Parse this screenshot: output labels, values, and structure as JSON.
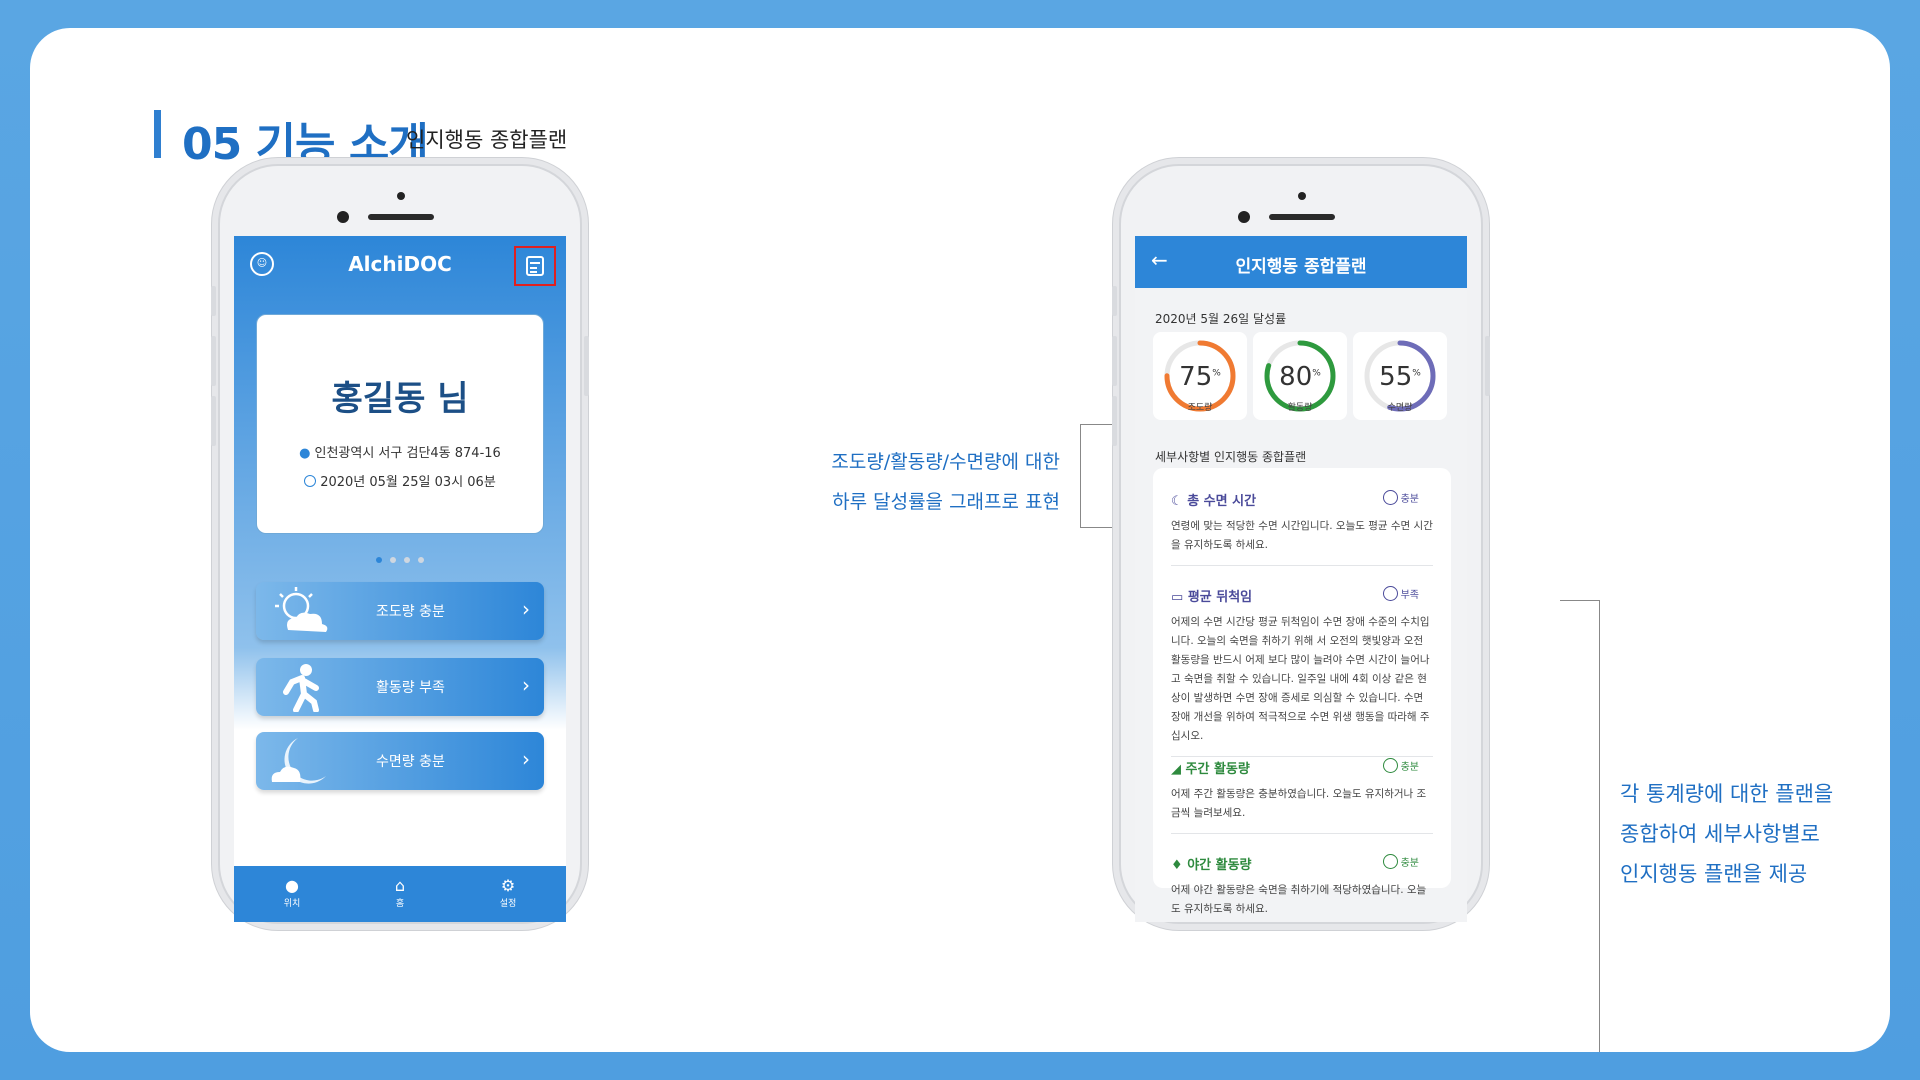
{
  "slide": {
    "title": "05 기능 소개",
    "subtitle": "인지행동 종합플랜"
  },
  "phone1": {
    "app_title": "AlchiDOC",
    "user_name": "홍길동 님",
    "address": "인천광역시 서구 검단4동 874-16",
    "datetime": "2020년 05월 25일 03시 06분",
    "page_indicator": {
      "total": 4,
      "active": 1
    },
    "menu": [
      {
        "label": "조도량 충분",
        "icon": "sun-cloud-icon"
      },
      {
        "label": "활동량 부족",
        "icon": "walking-person-icon"
      },
      {
        "label": "수면량 충분",
        "icon": "moon-cloud-icon"
      }
    ],
    "nav": [
      {
        "label": "위치",
        "icon": "location-pin-icon"
      },
      {
        "label": "홈",
        "icon": "home-icon"
      },
      {
        "label": "설정",
        "icon": "gear-icon"
      }
    ]
  },
  "phone2": {
    "title": "인지행동 종합플랜",
    "rate_title": "2020년 5월 26일 달성률",
    "gauges": [
      {
        "value": "75",
        "unit": "%",
        "label": "조도량",
        "fraction": 0.75,
        "color": "#f07a32"
      },
      {
        "value": "80",
        "unit": "%",
        "label": "활동량",
        "fraction": 0.8,
        "color": "#2e9a3e"
      },
      {
        "value": "55",
        "unit": "%",
        "label": "수면량",
        "fraction": 0.55,
        "color": "#6e6cb8"
      }
    ],
    "detail_title": "세부사항별 인지행동 종합플랜",
    "sections": [
      {
        "title": "총 수면 시간",
        "status": "충분",
        "color": "#4a4a9a",
        "body": "연령에 맞는 적당한 수면 시간입니다. 오늘도 평균 수면 시간을 유지하도록 하세요."
      },
      {
        "title": "평균 뒤척임",
        "status": "부족",
        "color": "#4a4a9a",
        "body": "어제의 수면 시간당 평균 뒤척임이 수면 장애 수준의 수치입니다. 오늘의 숙면을 취하기 위해 서 오전의 햇빛양과 오전 활동량을 반드시 어제 보다 많이 늘려야 수면 시간이 늘어나고 숙면을 취할 수 있습니다. 일주일 내에 4회 이상 같은 현상이 발생하면 수면 장애 증세로 의심할 수 있습니다. 수면 장애 개선을 위하여 적극적으로 수면 위생 행동을 따라해 주십시오."
      },
      {
        "title": "주간 활동량",
        "status": "충분",
        "color": "#2e8a3e",
        "body": "어제 주간 활동량은 충분하였습니다. 오늘도 유지하거나 조금씩 늘려보세요."
      },
      {
        "title": "야간 활동량",
        "status": "충분",
        "color": "#2e8a3e",
        "body": "어제 야간 활동량은 숙면을 취하기에 적당하였습니다. 오늘도 유지하도록 하세요."
      }
    ]
  },
  "callouts": {
    "left_line1": "조도량/활동량/수면량에 대한",
    "left_line2": "하루 달성률을 그래프로 표현",
    "right_line1": "각 통계량에 대한 플랜을",
    "right_line2": "종합하여 세부사항별로",
    "right_line3": "인지행동 플랜을 제공"
  }
}
